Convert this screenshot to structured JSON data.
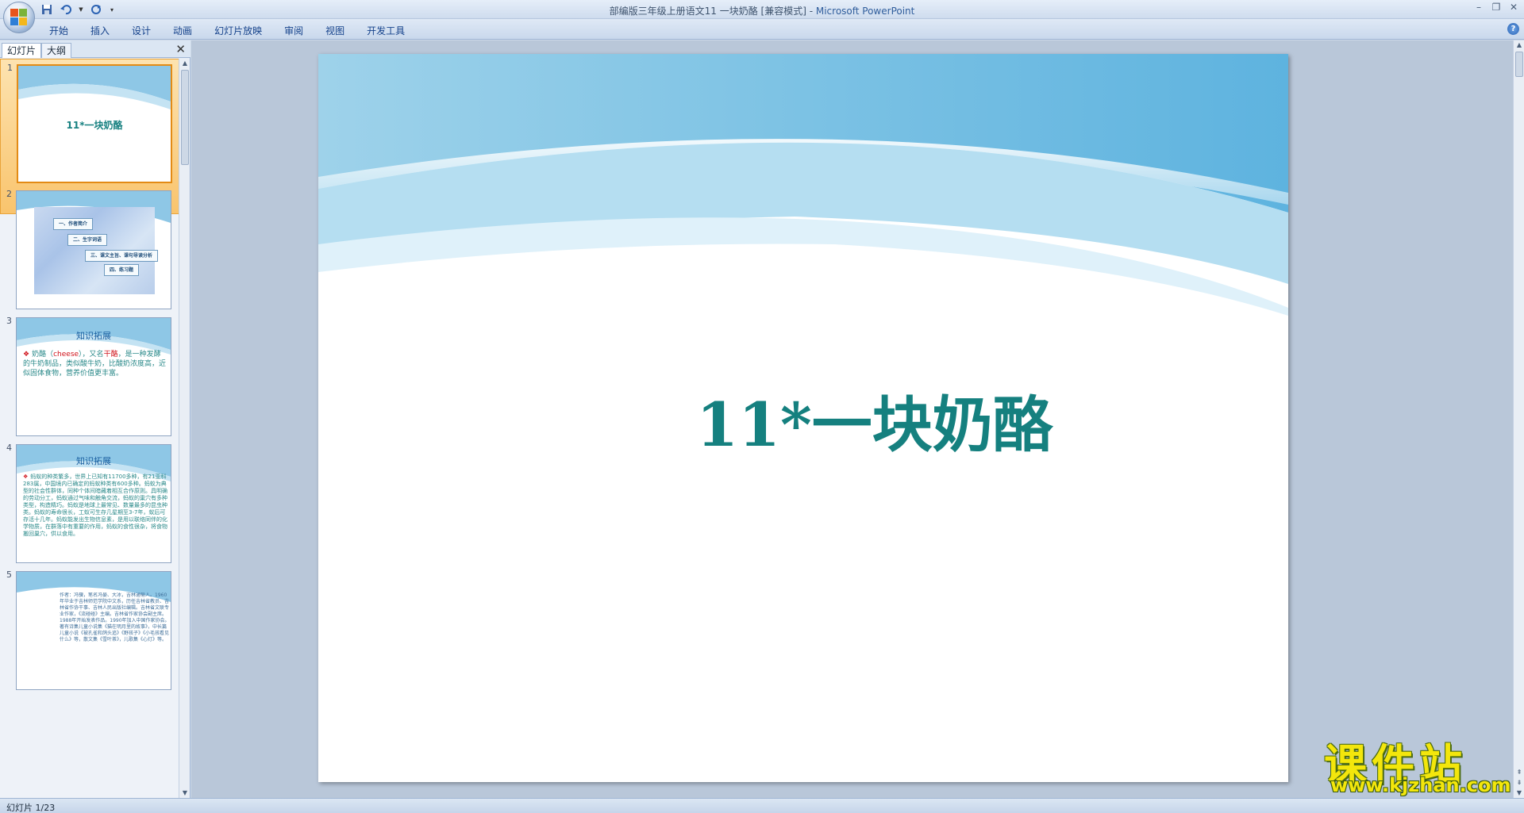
{
  "window": {
    "title_doc": "部编版三年级上册语文11 一块奶酪 [兼容模式]",
    "title_sep": " - ",
    "title_app": "Microsoft PowerPoint"
  },
  "ribbon": {
    "tabs": [
      "开始",
      "插入",
      "设计",
      "动画",
      "幻灯片放映",
      "审阅",
      "视图",
      "开发工具"
    ]
  },
  "panel": {
    "tab_slides": "幻灯片",
    "tab_outline": "大纲"
  },
  "thumbnails": [
    {
      "num": "1",
      "title": "11*一块奶酪"
    },
    {
      "num": "2",
      "items": [
        "一、作者简介",
        "二、生字词语",
        "三、课文主旨、课句导读分析",
        "四、练习题"
      ]
    },
    {
      "num": "3",
      "title": "知识拓展",
      "body_pre": "奶酪（",
      "body_kw": "cheese",
      "body_mid": "），又名",
      "body_red": "干酪",
      "body_post": "，是一种发酵的牛奶制品，类似酸牛奶，比酸奶浓度高，近似固体食物，营养价值更丰富。"
    },
    {
      "num": "4",
      "title": "知识拓展",
      "body": "蚂蚁的种类繁多，世界上已知有11700多种，有21亚科283属，中国境内已确定的蚂蚁种类有600多种。蚂蚁为典型的社会性群体，同种个体间暗藏着相互合作原则。具明确的劳动分工，蚂蚁通过气味和触角交流，蚂蚁的巢穴有多种类型，构造精巧。蚂蚁是地球上最常见、数量最多的昆虫种类。蚂蚁的寿命很长，工蚁可生存几星期至3-7年，蚁后可存活十几年。蚂蚁能发出生物信息素，是用以联络同伴的化学物质，在群落中有重要的作用，蚂蚁的食性很杂，将食物搬回巢穴，供以食用。"
    },
    {
      "num": "5",
      "body": "作者：冯骥，笔名冯晏、大冰，吉林通榆人。1960年毕业于吉林师范学院中文系，历任吉林省教员、吉林省作协干事、吉林人民出版社编辑。吉林省文联专业作家，《流碰碰》主编。吉林省作家协会副主席。1988年开始发表作品。1990年加入中国作家协会。著有诗集儿童小说集《猫在明月里的故事》，中长篇儿童小说《被孔雀和鸽头追》《野孩子》《小毛孩看见什么》等，散文集《雪叶茶》，儿歌集《心灯》等。"
    }
  ],
  "slide": {
    "title": "11*一块奶酪"
  },
  "status": {
    "slide_label": "幻灯片 1/23"
  },
  "watermark": {
    "main": "课件站",
    "url": "www.kjzhan.com"
  }
}
